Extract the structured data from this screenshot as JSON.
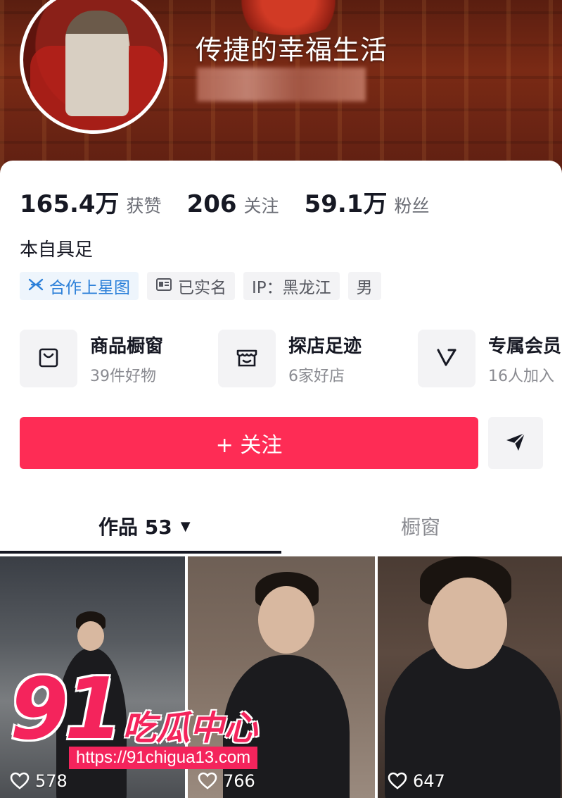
{
  "profile": {
    "nickname": "传捷的幸福生活",
    "bio": "本自具足"
  },
  "stats": [
    {
      "value": "165.4万",
      "label": "获赞"
    },
    {
      "value": "206",
      "label": "关注"
    },
    {
      "value": "59.1万",
      "label": "粉丝"
    }
  ],
  "tags": {
    "cooperation": "合作上星图",
    "verified": "已实名",
    "ip": "IP：黑龙江",
    "gender": "男"
  },
  "features": [
    {
      "title": "商品橱窗",
      "subtitle": "39件好物",
      "icon": "shopping-bag-icon"
    },
    {
      "title": "探店足迹",
      "subtitle": "6家好店",
      "icon": "store-icon"
    },
    {
      "title": "专属会员",
      "subtitle": "16人加入",
      "icon": "vip-v-icon"
    }
  ],
  "actions": {
    "follow": "+ 关注"
  },
  "tabs": {
    "works": "作品 53",
    "showcase": "橱窗"
  },
  "videos": [
    {
      "likes": "578"
    },
    {
      "likes": "766"
    },
    {
      "likes": "647"
    }
  ],
  "watermark": {
    "number": "91",
    "text": "吃瓜中心",
    "url": "https://91chigua13.com"
  },
  "colors": {
    "accent": "#fe2c55",
    "verified_blue": "#2c80d9",
    "watermark": "#f4245c"
  }
}
